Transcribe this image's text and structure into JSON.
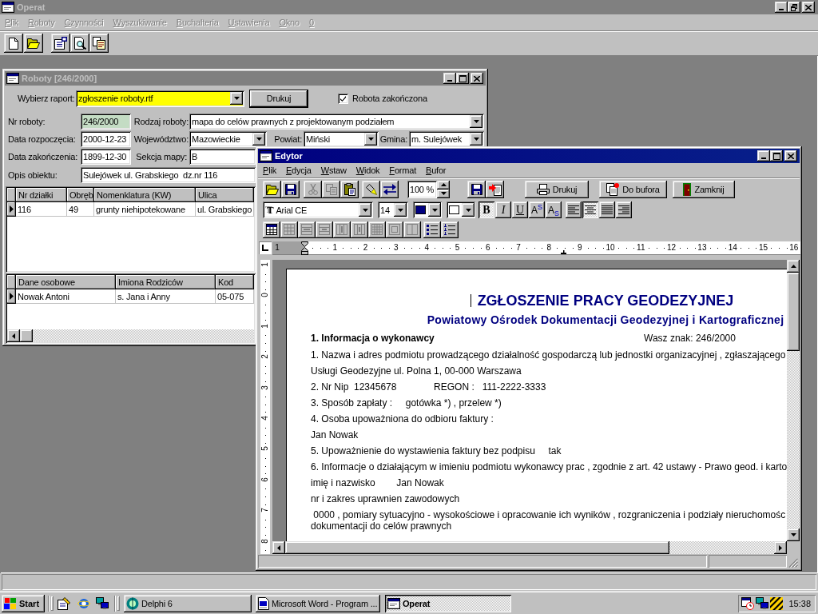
{
  "app_window": {
    "title": "Operat",
    "active": false,
    "menu": [
      {
        "label": "Plik",
        "disabled": true
      },
      {
        "label": "Roboty",
        "disabled": true
      },
      {
        "label": "Czynności",
        "disabled": true
      },
      {
        "label": "Wyszukiwanie",
        "disabled": true
      },
      {
        "label": "Buchalteria",
        "disabled": true
      },
      {
        "label": "Ustawienia",
        "disabled": true
      },
      {
        "label": "Okno",
        "disabled": true
      },
      {
        "label": "0",
        "disabled": true
      }
    ]
  },
  "roboty_window": {
    "title": "Roboty [246/2000]",
    "active": false,
    "report": {
      "label": "Wybierz raport:",
      "value": "zgłoszenie roboty.rtf",
      "focused": true
    },
    "print_button": "Drukuj",
    "finished": {
      "label": "Robota zakończona",
      "checked": true
    },
    "nr_roboty": {
      "label": "Nr roboty:",
      "value": "246/2000",
      "readonly": true
    },
    "rodzaj_roboty": {
      "label": "Rodzaj roboty:",
      "value": "mapa do celów prawnych z projektowanym podziałem"
    },
    "data_rozpoczecia": {
      "label": "Data rozpoczęcia:",
      "value": "2000-12-23",
      "readonly": false
    },
    "wojewodztwo": {
      "label": "Województwo:",
      "value": "Mazowieckie"
    },
    "powiat": {
      "label": "Powiat:",
      "value": "Miński"
    },
    "gmina": {
      "label": "Gmina:",
      "value": "m. Sulejówek"
    },
    "data_zakonczenia": {
      "label": "Data zakończenia:",
      "value": "1899-12-30",
      "readonly": false
    },
    "sekcja_mapy": {
      "label": "Sekcja mapy:",
      "value": "B",
      "readonly": false
    },
    "opis_obiektu": {
      "label": "Opis obiektu:",
      "value": "Sulejówek ul. Grabskiego  dz.nr 116",
      "readonly": false
    },
    "plots_table": {
      "columns": [
        "Nr działki",
        "Obręb",
        "Nomenklatura (KW)",
        "Ulica"
      ],
      "rows": [
        {
          "cells": [
            "116",
            "49",
            "grunty niehipotekowane",
            "ul. Grabskiego"
          ],
          "selected": true
        }
      ]
    },
    "persons_table": {
      "columns": [
        "Dane osobowe",
        "Imiona Rodziców",
        "Kod"
      ],
      "rows": [
        {
          "cells": [
            "Nowak Antoni",
            "s. Jana i Anny",
            "05-075"
          ],
          "selected": true
        }
      ]
    }
  },
  "editor_window": {
    "title": "Edytor",
    "active": true,
    "menu": [
      "Plik",
      "Edycja",
      "Wstaw",
      "Widok",
      "Format",
      "Bufor"
    ],
    "file_tools": [
      {
        "kind": "open",
        "disabled": false
      },
      {
        "kind": "save",
        "disabled": false
      }
    ],
    "edit_tools": [
      {
        "kind": "cut",
        "disabled": true
      },
      {
        "kind": "copy",
        "disabled": true
      },
      {
        "kind": "paste",
        "disabled": false
      }
    ],
    "search_tools": [
      {
        "kind": "highlight",
        "disabled": false
      },
      {
        "kind": "replace",
        "disabled": false
      }
    ],
    "zoom": "100 %",
    "export_tools": [
      {
        "kind": "save",
        "disabled": false
      },
      {
        "kind": "export",
        "disabled": false
      }
    ],
    "action_buttons": [
      {
        "kind": "print",
        "label": "Drukuj"
      },
      {
        "kind": "buffer",
        "label": "Do bufora"
      },
      {
        "kind": "close",
        "label": "Zamknij"
      }
    ],
    "font_symbol": "T",
    "font": "Arial CE",
    "font_size": "14",
    "color_pickers": [
      {
        "color": "#000080"
      },
      {
        "color": "#ffffff"
      }
    ],
    "style_buttons": [
      {
        "kind": "bold",
        "label": "B",
        "pressed": true
      },
      {
        "kind": "italic",
        "label": "I",
        "pressed": false
      },
      {
        "kind": "underline",
        "label": "U",
        "pressed": false
      },
      {
        "kind": "superscript",
        "label": "A$^{S}$",
        "pressed": false
      },
      {
        "kind": "subscript",
        "label": "A$_{S}$",
        "pressed": false
      }
    ],
    "align_buttons": [
      {
        "kind": "left",
        "selected": false
      },
      {
        "kind": "center",
        "selected": true
      },
      {
        "kind": "justify",
        "selected": false
      },
      {
        "kind": "right",
        "selected": false
      }
    ],
    "table_tools": [
      {
        "kind": "table",
        "disabled": false
      },
      {
        "kind": "cells",
        "disabled": true
      },
      {
        "kind": "insert_row",
        "disabled": true
      },
      {
        "kind": "delete_row",
        "disabled": true
      },
      {
        "kind": "insert_column",
        "disabled": true
      },
      {
        "kind": "delete_column",
        "disabled": true
      },
      {
        "kind": "grid",
        "disabled": true
      },
      {
        "kind": "merge_cells",
        "disabled": true
      },
      {
        "kind": "split_cells",
        "disabled": true
      }
    ],
    "list_tools": [
      {
        "kind": "bullets",
        "disabled": false
      },
      {
        "kind": "numbering",
        "disabled": false
      }
    ],
    "ruler": [
      "1",
      "1",
      "2",
      "3",
      "4",
      "5",
      "6",
      "7",
      "8",
      "9",
      "10",
      "11",
      "12",
      "13",
      "14",
      "15",
      "16"
    ],
    "vertical_ruler": [
      "1",
      "0",
      "1",
      "2",
      "3",
      "4",
      "5",
      "6",
      "7",
      "8"
    ],
    "document": {
      "title": "ZGŁOSZENIE PRACY GEODEZYJNEJ",
      "subtitle": "Powiatowy Ośrodek Dokumentacji Geodezyjnej i Kartograficznej",
      "section": "1. Informacja o wykonawcy",
      "reference": "Wasz znak: 246/2000",
      "paragraphs": [
        [
          "1. Nazwa i adres podmiotu prowadzącego działalność gospodarczą lub jednostki organizacyjnej , zgłaszającego"
        ],
        [
          "Usługi Geodezyjne ul. Polna 1, 00-000 Warszawa"
        ],
        [
          "2. Nr Nip  12345678              REGON :   111-2222-3333"
        ],
        [
          "3. Sposób zapłaty :     gotówka *) , przelew *)"
        ],
        [
          "4. Osoba upoważniona do odbioru faktury :"
        ],
        [
          "Jan Nowak"
        ],
        [
          "5. Upoważnienie do wystawienia faktury bez podpisu     tak"
        ],
        [
          "6. Informacje o działającym w imieniu podmiotu wykonawcy prac , zgodnie z art. 42 ustawy - Prawo geod. i karto"
        ],
        [
          "imię i nazwisko        Jan Nowak"
        ],
        [
          "nr i zakres uprawnien zawodowych"
        ],
        [
          " 0000 , pomiary sytuacyjno - wysokościowe i opracowanie ich wyników , rozgraniczenia i podziały nieruchomośc",
          "dokumentacji do celów prawnych"
        ]
      ]
    }
  },
  "taskbar": {
    "start": "Start",
    "tasks": [
      {
        "kind": "delphi",
        "label": "Delphi 6",
        "selected": false
      },
      {
        "kind": "word",
        "label": "Microsoft Word - Program ...",
        "selected": false
      },
      {
        "kind": "app",
        "label": "Operat",
        "selected": true
      }
    ],
    "clock": "15:38"
  }
}
